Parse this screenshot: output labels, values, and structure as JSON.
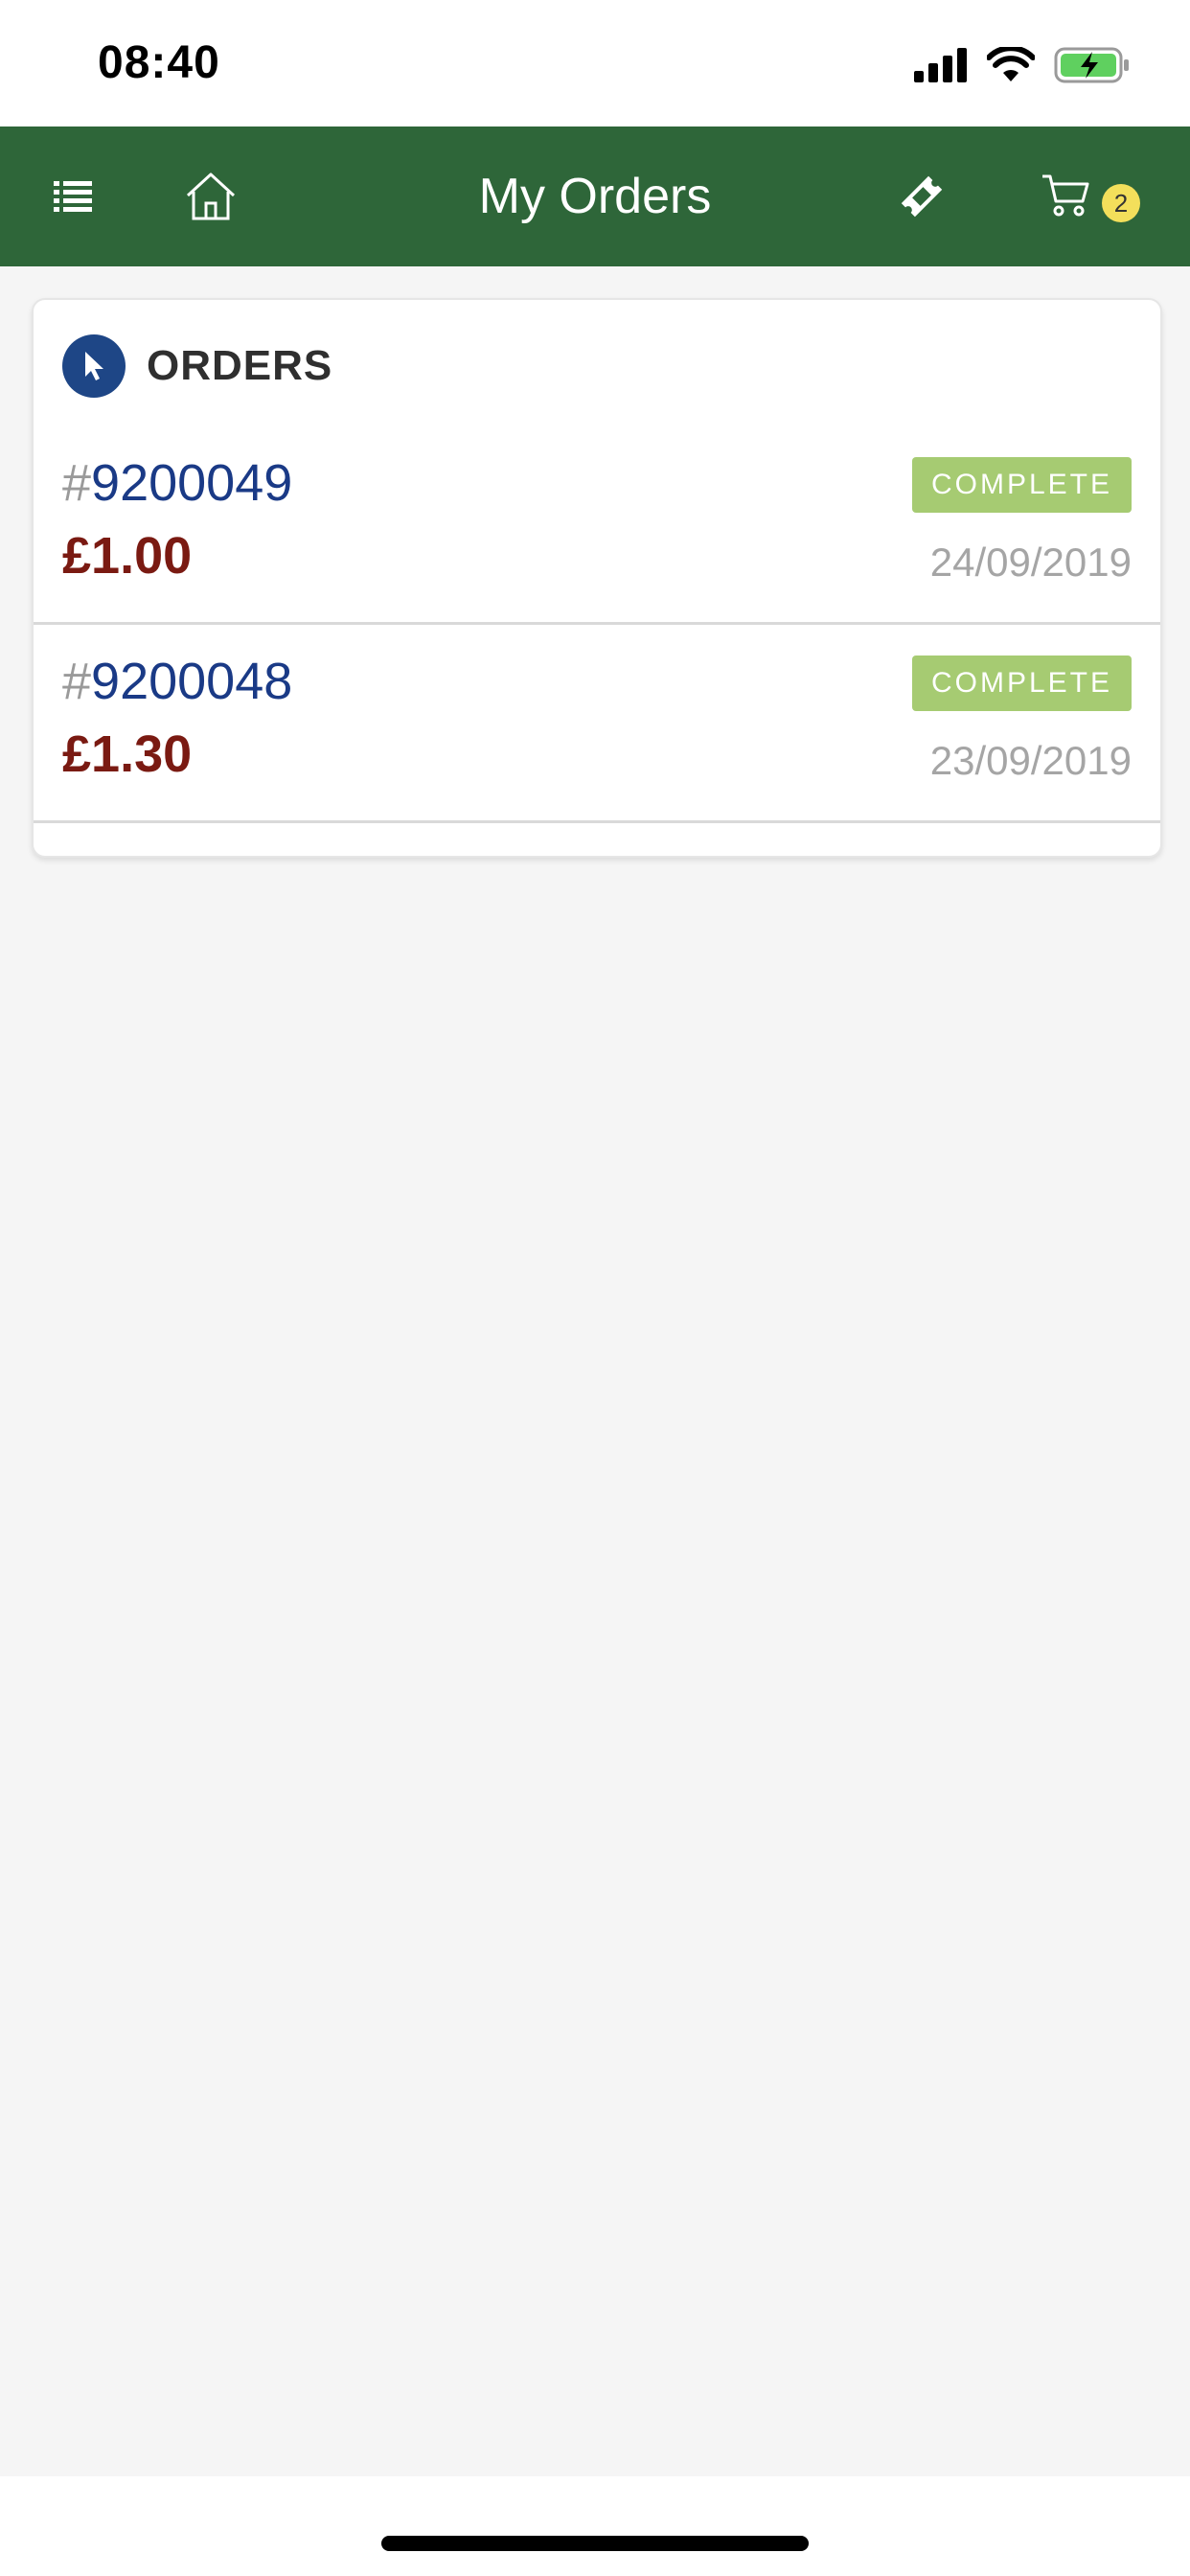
{
  "status_bar": {
    "time": "08:40"
  },
  "header": {
    "title": "My Orders",
    "cart_count": "2",
    "icons": [
      "list-icon",
      "home-icon",
      "ticket-icon",
      "cart-icon"
    ],
    "background_color": "#2e6639"
  },
  "orders": {
    "title": "ORDERS",
    "items": [
      {
        "hash": "#",
        "number": "9200049",
        "total": "£1.00",
        "status": "COMPLETE",
        "date": "24/09/2019"
      },
      {
        "hash": "#",
        "number": "9200048",
        "total": "£1.30",
        "status": "COMPLETE",
        "date": "23/09/2019"
      }
    ]
  },
  "colors": {
    "order_number": "#1a3a86",
    "order_total": "#7a1a12",
    "status_badge": "#a6cb72",
    "cart_badge": "#f3df5b"
  }
}
